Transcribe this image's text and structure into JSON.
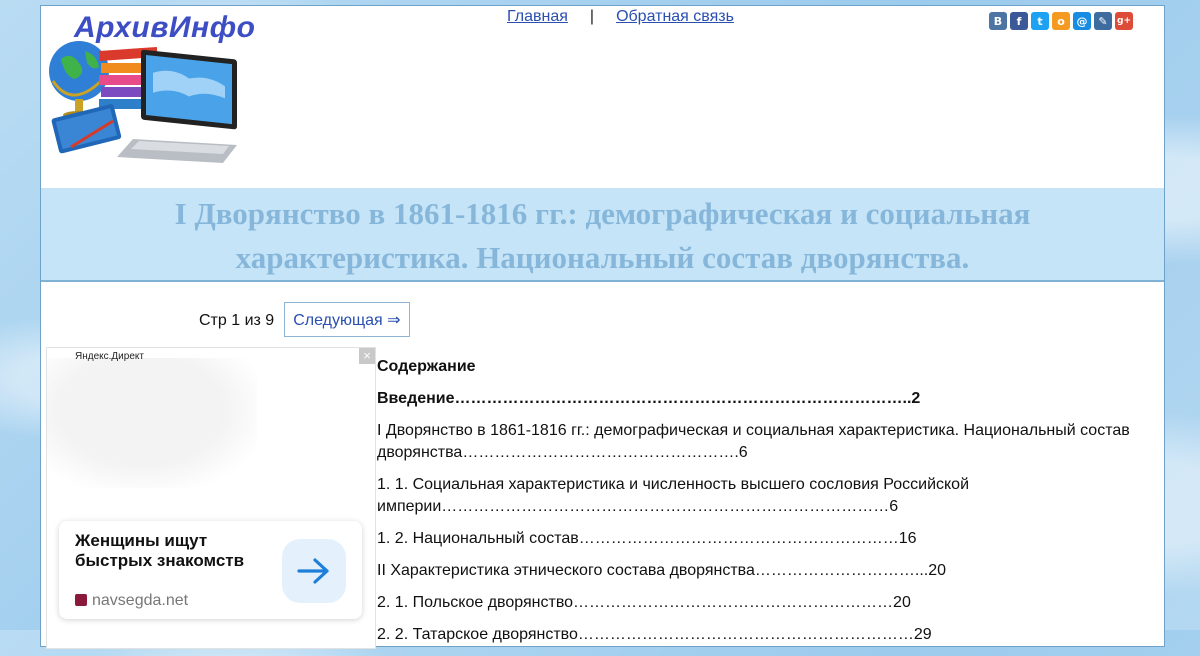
{
  "site": {
    "logo_text": "АрхивИнфо"
  },
  "nav": {
    "home": "Главная",
    "separator": "|",
    "feedback": "Обратная связь"
  },
  "share_icons": [
    {
      "name": "vk-icon",
      "glyph": "B",
      "color": "#4c75a3"
    },
    {
      "name": "facebook-icon",
      "glyph": "f",
      "color": "#3b5998"
    },
    {
      "name": "twitter-icon",
      "glyph": "t",
      "color": "#1da1f2"
    },
    {
      "name": "odnoklassniki-icon",
      "glyph": "o",
      "color": "#f59a20"
    },
    {
      "name": "mailru-icon",
      "glyph": "@",
      "color": "#168de2"
    },
    {
      "name": "livejournal-icon",
      "glyph": "✎",
      "color": "#3e6c9e"
    },
    {
      "name": "googleplus-icon",
      "glyph": "g+",
      "color": "#dd4b39"
    }
  ],
  "title_line1": "I Дворянство в 1861-1816 гг.: демографическая и социальная",
  "title_line2": "характеристика. Национальный состав дворянства.",
  "pager": {
    "page_info": "Стр 1 из 9",
    "next_label": "Следующая ⇒"
  },
  "ad": {
    "label": "Яндекс.Директ",
    "close": "×",
    "headline": "Женщины ищут быстрых знакомств",
    "domain": "navsegda.net"
  },
  "toc": [
    {
      "text": "Содержание",
      "bold": true
    },
    {
      "text": "Введение…………………………………………………………………………..2",
      "bold": true
    },
    {
      "text": "I Дворянство в 1861-1816 гг.: демографическая и социальная характеристика. Национальный состав дворянства…………………………………………….6",
      "bold": false
    },
    {
      "text": "1. 1. Социальная характеристика и численность высшего сословия Российской империи…………………………………………………………………………6",
      "bold": false
    },
    {
      "text": "1. 2. Национальный состав……………………………………………………16",
      "bold": false
    },
    {
      "text": "II Характеристика этнического состава дворянства…………………………...20",
      "bold": false
    },
    {
      "text": "2. 1. Польское дворянство……………………………………………………20",
      "bold": false
    },
    {
      "text": "2. 2. Татарское дворянство………………………………………………………29",
      "bold": false
    }
  ]
}
